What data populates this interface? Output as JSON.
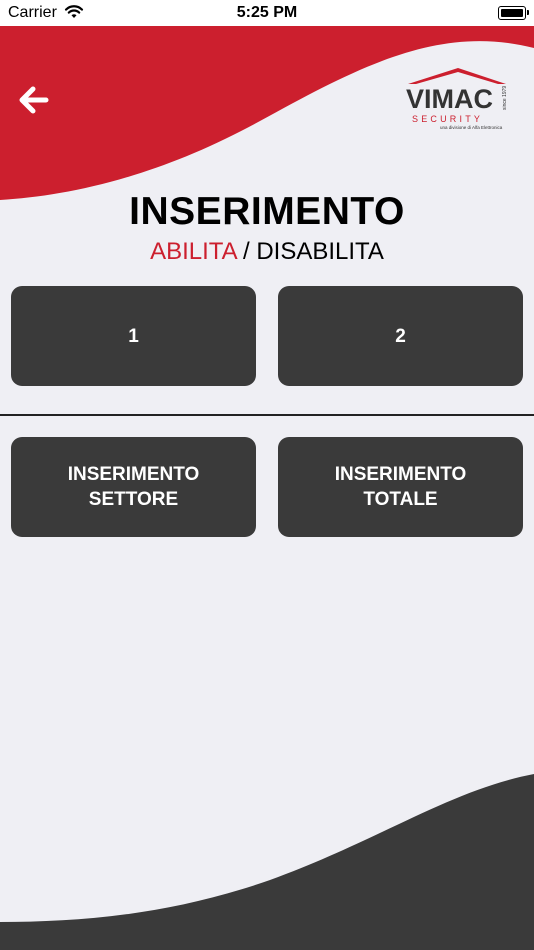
{
  "status_bar": {
    "carrier": "Carrier",
    "time": "5:25 PM"
  },
  "header": {
    "back_icon": "arrow-left-icon",
    "logo": {
      "brand": "VIMAC",
      "tagline": "SECURITY",
      "since": "since 1979",
      "division": "una divisione di Alfa Elettronica"
    }
  },
  "page": {
    "title": "INSERIMENTO",
    "subtitle_active": "ABILITA",
    "subtitle_separator": " / ",
    "subtitle_inactive": "DISABILITA"
  },
  "zones": [
    {
      "label": "1"
    },
    {
      "label": "2"
    }
  ],
  "actions": {
    "settore_line1": "INSERIMENTO",
    "settore_line2": "SETTORE",
    "totale_line1": "INSERIMENTO",
    "totale_line2": "TOTALE"
  },
  "colors": {
    "accent_red": "#cc1f2e",
    "button_dark": "#3a3a3a",
    "background": "#efeff4"
  }
}
